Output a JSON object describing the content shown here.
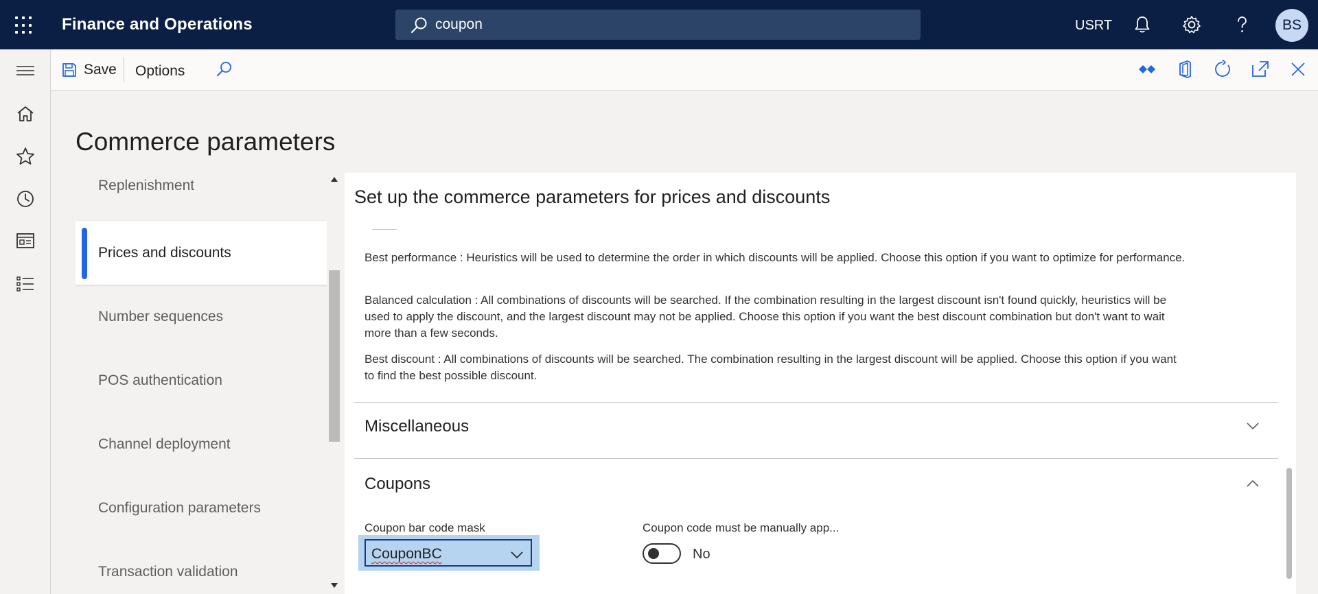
{
  "app": {
    "title": "Finance and Operations",
    "company": "USRT",
    "avatar_initials": "BS"
  },
  "search": {
    "value": "coupon"
  },
  "actionbar": {
    "save_label": "Save",
    "options_label": "Options"
  },
  "page": {
    "title": "Commerce parameters"
  },
  "nav": {
    "items": [
      {
        "label": "Replenishment"
      },
      {
        "label": "Prices and discounts"
      },
      {
        "label": "Number sequences"
      },
      {
        "label": "POS authentication"
      },
      {
        "label": "Channel deployment"
      },
      {
        "label": "Configuration parameters"
      },
      {
        "label": "Transaction validation"
      }
    ],
    "selected": "Prices and discounts"
  },
  "content": {
    "title": "Set up the commerce parameters for prices and discounts",
    "paragraphs": [
      "Best performance : Heuristics will be used to determine the order in which discounts will be applied. Choose this option if you want to optimize for performance.",
      "Balanced calculation : All combinations of discounts will be searched. If the combination resulting in the largest discount isn't found quickly, heuristics will be used to apply the discount, and the largest discount may not be applied. Choose this option if you want the best discount combination but don't want to wait more than a few seconds.",
      "Best discount : All combinations of discounts will be searched. The combination resulting in the largest discount will be applied. Choose this option if you want to find the best possible discount."
    ],
    "sections": {
      "miscellaneous": "Miscellaneous",
      "coupons": "Coupons"
    },
    "coupons": {
      "barcode_mask_label": "Coupon bar code mask",
      "barcode_mask_value": "CouponBC",
      "manual_apply_label": "Coupon code must be manually app...",
      "manual_apply_value": "No"
    }
  },
  "colors": {
    "topbar": "#0b1f44",
    "accent": "#2266e3",
    "icon_blue": "#2266e3",
    "selection": "#b6d3ef"
  }
}
